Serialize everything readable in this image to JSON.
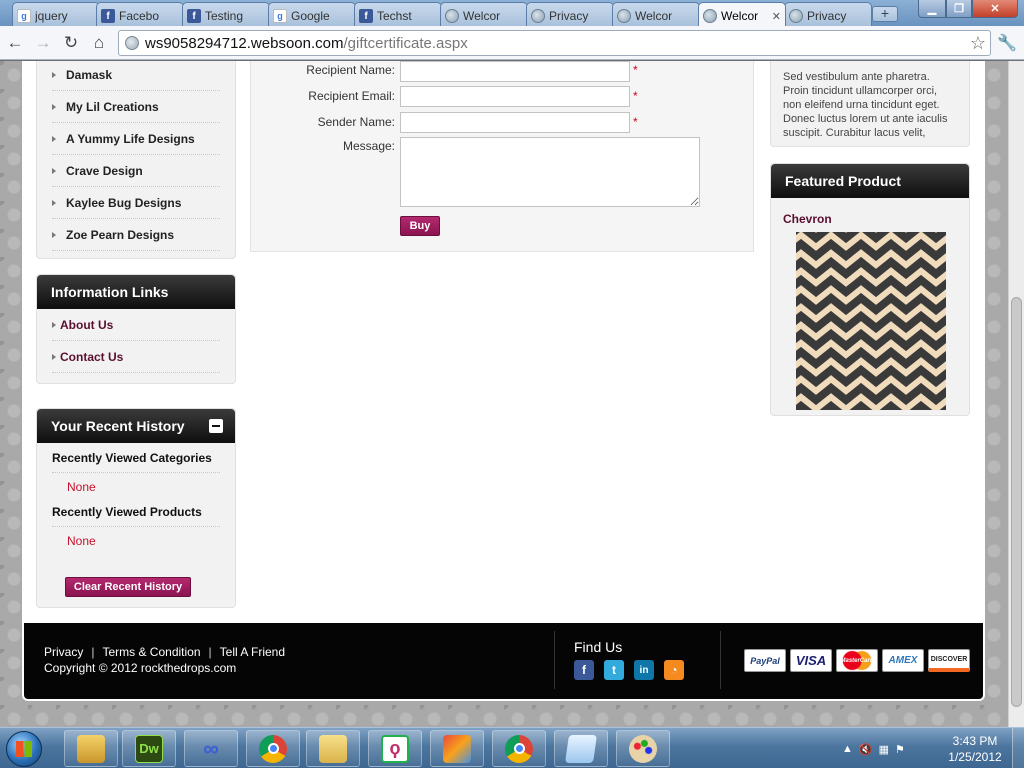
{
  "browser": {
    "tabs": [
      {
        "label": "jquery",
        "icon": "google-icon",
        "active": false
      },
      {
        "label": "Facebo",
        "icon": "facebook-icon",
        "active": false
      },
      {
        "label": "Testing",
        "icon": "facebook-icon",
        "active": false
      },
      {
        "label": "Google",
        "icon": "google-icon",
        "active": false
      },
      {
        "label": "Techst",
        "icon": "facebook-icon",
        "active": false
      },
      {
        "label": "Welcor",
        "icon": "globe-icon",
        "active": false
      },
      {
        "label": "Privacy",
        "icon": "globe-icon",
        "active": false
      },
      {
        "label": "Welcor",
        "icon": "globe-icon",
        "active": false
      },
      {
        "label": "Welcor",
        "icon": "globe-icon",
        "active": true
      },
      {
        "label": "Privacy",
        "icon": "globe-icon",
        "active": false
      }
    ],
    "url_host": "ws9058294712.websoon.com",
    "url_path": "/giftcertificate.aspx"
  },
  "sidebar": {
    "categories": [
      "Damask",
      "My Lil Creations",
      "A Yummy Life Designs",
      "Crave Design",
      "Kaylee Bug Designs",
      "Zoe Pearn Designs"
    ],
    "info_title": "Information Links",
    "info_links": [
      "About Us",
      "Contact Us"
    ],
    "history_title": "Your Recent History",
    "recent_categories_label": "Recently Viewed Categories",
    "recent_categories_value": "None",
    "recent_products_label": "Recently Viewed Products",
    "recent_products_value": "None",
    "clear_history_label": "Clear Recent History"
  },
  "form": {
    "recipient_name_label": "Recipient Name:",
    "recipient_email_label": "Recipient Email:",
    "sender_name_label": "Sender Name:",
    "message_label": "Message:",
    "required_mark": "*",
    "buy_label": "Buy"
  },
  "right": {
    "promo_text": "Sed vestibulum ante pharetra. Proin tincidunt ullamcorper orci, non eleifend urna tincidunt eget. Donec luctus lorem ut ante iaculis suscipit. Curabitur lacus velit,",
    "featured_title": "Featured Product",
    "featured_product_name": "Chevron"
  },
  "footer": {
    "links": [
      "Privacy",
      "Terms & Condition",
      "Tell A Friend"
    ],
    "separator": "|",
    "copyright": "Copyright © 2012 rockthedrops.com",
    "find_us": "Find Us",
    "social": [
      "facebook-icon",
      "twitter-icon",
      "linkedin-icon",
      "rss-icon"
    ],
    "payment_cards": [
      "PayPal",
      "VISA",
      "MasterCard",
      "AMEX",
      "DISCOVER"
    ]
  },
  "taskbar": {
    "time": "3:43 PM",
    "date": "1/25/2012"
  },
  "colors": {
    "accent_purple": "#8a1450",
    "link_maroon": "#5a0f30",
    "required_red": "#d0021b"
  }
}
